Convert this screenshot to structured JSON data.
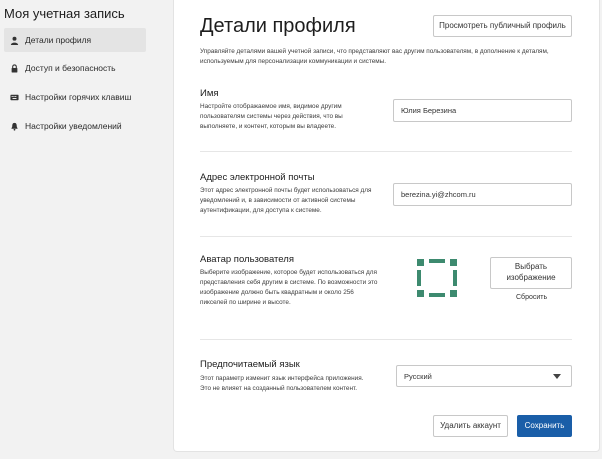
{
  "sidebar": {
    "title": "Моя учетная запись",
    "items": [
      {
        "label": "Детали профиля",
        "icon": "person-icon",
        "active": true
      },
      {
        "label": "Доступ и безопасность",
        "icon": "lock-icon",
        "active": false
      },
      {
        "label": "Настройки горячих клавиш",
        "icon": "keyboard-icon",
        "active": false
      },
      {
        "label": "Настройки уведомлений",
        "icon": "bell-icon",
        "active": false
      }
    ]
  },
  "main": {
    "title": "Детали профиля",
    "view_public_profile_label": "Просмотреть публичный профиль",
    "intro": "Управляйте деталями вашей учетной записи, что представляют вас другим пользователям, в дополнение к деталям, используемым для персонализации коммуникации и системы.",
    "name": {
      "title": "Имя",
      "description": "Настройте отображаемое имя, видимое другим пользователям системы через действия, что вы выполняете, и контент, которым вы владеете.",
      "value": "Юлия Березина"
    },
    "email": {
      "title": "Адрес электронной почты",
      "description": "Этот адрес электронной почты будет использоваться для уведомлений и, в зависимости от активной системы аутентификации, для доступа к системе.",
      "value": "berezina.yi@zhcom.ru"
    },
    "avatar": {
      "title": "Аватар пользователя",
      "description": "Выберите изображение, которое будет использоваться для представления себя другим в системе. По возможности это изображение должно быть квадратным и около 256 пикселей по ширине и высоте.",
      "choose_label": "Выбрать изображение",
      "reset_label": "Сбросить",
      "avatar_color": "#3d8a6f"
    },
    "language": {
      "title": "Предпочитаемый язык",
      "description": "Этот параметр изменит язык интерфейса приложения. Это не влияет на созданный пользователем контент.",
      "selected": "Русский"
    },
    "delete_account_label": "Удалить аккаунт",
    "save_label": "Сохранить",
    "primary_color": "#1a5ea8"
  }
}
